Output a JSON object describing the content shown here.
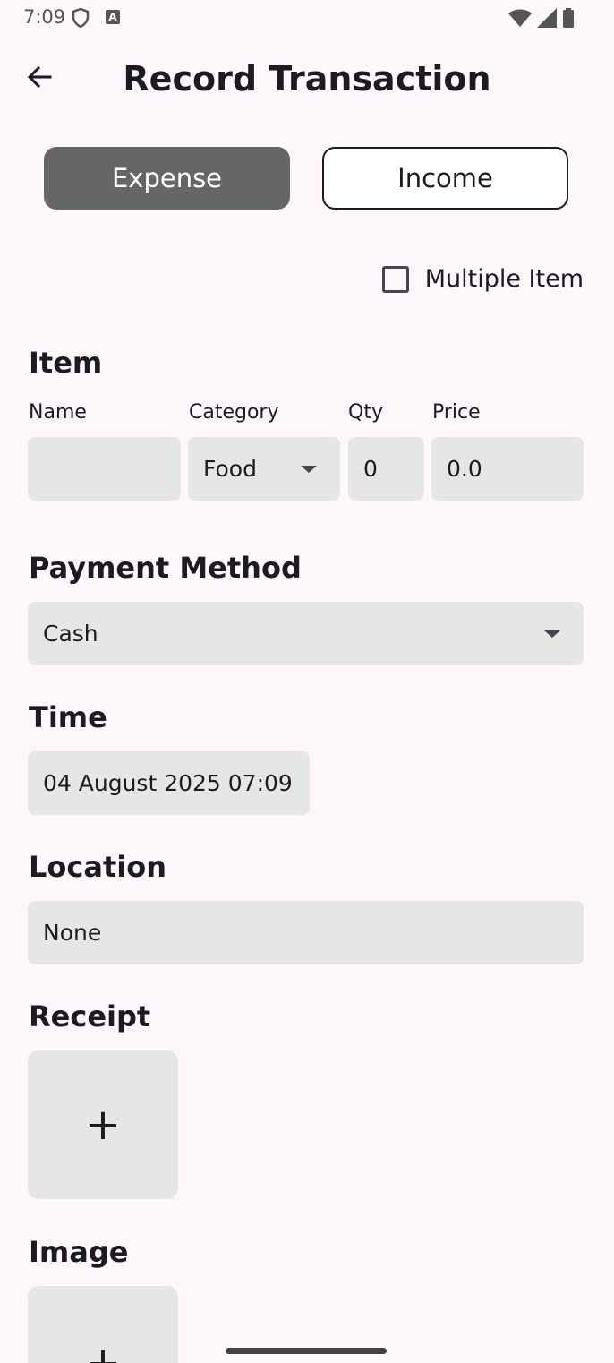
{
  "status_bar": {
    "time": "7:09"
  },
  "header": {
    "title": "Record Transaction"
  },
  "type_toggle": {
    "expense_label": "Expense",
    "income_label": "Income"
  },
  "multiple_item": {
    "label": "Multiple Item",
    "checked": false
  },
  "item_section": {
    "title": "Item",
    "name_label": "Name",
    "name_value": "",
    "category_label": "Category",
    "category_value": "Food",
    "qty_label": "Qty",
    "qty_value": "0",
    "price_label": "Price",
    "price_value": "0.0"
  },
  "payment_section": {
    "title": "Payment Method",
    "value": "Cash"
  },
  "time_section": {
    "title": "Time",
    "value": "04 August 2025 07:09"
  },
  "location_section": {
    "title": "Location",
    "value": "None"
  },
  "receipt_section": {
    "title": "Receipt",
    "add_symbol": "+"
  },
  "image_section": {
    "title": "Image",
    "add_symbol": "+"
  },
  "colors": {
    "background": "#fdf7fc",
    "selected_toggle": "#666666",
    "field_fill": "#e6e6e6"
  }
}
